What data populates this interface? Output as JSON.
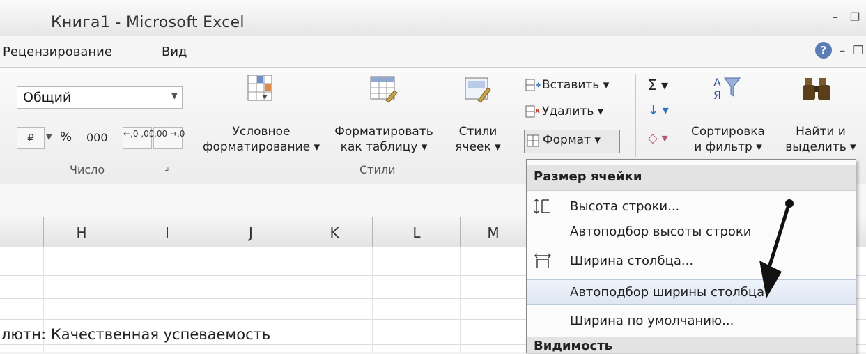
{
  "window": {
    "title": "Книга1 - Microsoft Excel",
    "min_glyph": "–",
    "restore_glyph": "❐",
    "close_glyph": "×"
  },
  "tabs": {
    "review": "Рецензирование",
    "view": "Вид",
    "help_glyph": "?",
    "min_glyph": "–",
    "restore_glyph": "❐"
  },
  "number_group": {
    "label": "Число",
    "format_value": "Общий",
    "currency_glyph": "₽",
    "percent": "%",
    "thousands": "000",
    "increase_decimal": "←,0 ,00",
    "decrease_decimal": ",00 →,0",
    "launcher_glyph": "⌟"
  },
  "styles_group": {
    "label": "Стили",
    "conditional_formatting": [
      "Условное",
      "форматирование ▾"
    ],
    "format_as_table": [
      "Форматировать",
      "как таблицу ▾"
    ],
    "cell_styles": [
      "Стили",
      "ячеек ▾"
    ]
  },
  "cells_group": {
    "insert": "Вставить ▾",
    "delete": "Удалить ▾",
    "format": "Формат ▾"
  },
  "editing_group": {
    "sigma_glyph": "Σ ▾",
    "fill_glyph": "↓ ▾",
    "clear_glyph": "◇ ▾",
    "sort_filter": [
      "Сортировка",
      "и фильтр ▾"
    ],
    "find_select": [
      "Найти и",
      "выделить ▾"
    ]
  },
  "columns": [
    "H",
    "I",
    "J",
    "K",
    "L",
    "M"
  ],
  "cell_text": "лютн: Качественная успеваемость",
  "format_menu": {
    "section_cell_size": "Размер ячейки",
    "row_height": "Высота строки...",
    "autofit_row_height": "Автоподбор высоты строки",
    "column_width": "Ширина столбца...",
    "autofit_column_width": "Автоподбор ширины столбца",
    "default_width": "Ширина по умолчанию...",
    "section_visibility": "Видимость"
  }
}
